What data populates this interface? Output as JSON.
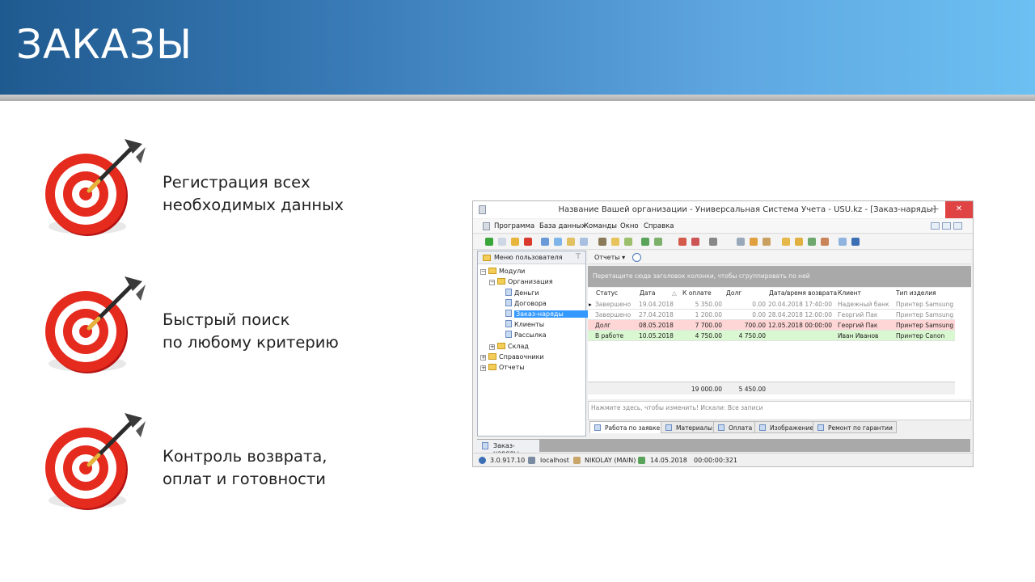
{
  "slide": {
    "title": "ЗАКАЗЫ",
    "features": [
      {
        "line1": "Регистрация всех",
        "line2": "необходимых данных"
      },
      {
        "line1": "Быстрый поиск",
        "line2": "по любому критерию"
      },
      {
        "line1": "Контроль возврата,",
        "line2": "оплат и готовности"
      }
    ]
  },
  "window": {
    "title": "Название Вашей организации - Универсальная Система Учета - USU.kz - [Заказ-наряды]",
    "controls": {
      "minimize": "—",
      "maximize": "☐",
      "close": "✕"
    },
    "menu": [
      "Программа",
      "База данных",
      "Команды",
      "Окно",
      "Справка"
    ],
    "sidebar": {
      "header": "Меню пользователя",
      "pin": "⊤",
      "tree": [
        {
          "label": "Модули",
          "type": "folder",
          "level": 0
        },
        {
          "label": "Организация",
          "type": "folder",
          "level": 1
        },
        {
          "label": "Деньги",
          "type": "doc",
          "level": 2
        },
        {
          "label": "Договора",
          "type": "doc",
          "level": 2
        },
        {
          "label": "Заказ-наряды",
          "type": "doc",
          "level": 2,
          "selected": true
        },
        {
          "label": "Клиенты",
          "type": "doc",
          "level": 2
        },
        {
          "label": "Рассылка",
          "type": "doc",
          "level": 2
        },
        {
          "label": "Склад",
          "type": "folder",
          "level": 1
        },
        {
          "label": "Справочники",
          "type": "folder",
          "level": 0
        },
        {
          "label": "Отчеты",
          "type": "folder",
          "level": 0
        }
      ]
    },
    "reports_button": "Отчеты ▾",
    "group_hint": "Перетащите сюда заголовок колонки, чтобы сгруппировать по ней",
    "grid": {
      "columns": [
        "Статус",
        "Дата",
        "К оплате",
        "Долг",
        "Дата/время возврата",
        "Клиент",
        "Тип изделия"
      ],
      "rows": [
        {
          "status": "Завершено",
          "date": "19.04.2018",
          "to_pay": "5 350.00",
          "debt": "0.00",
          "return": "20.04.2018 17:40:00",
          "client": "Надежный банк",
          "item": "Принтер Samsung",
          "kind": "done"
        },
        {
          "status": "Завершено",
          "date": "27.04.2018",
          "to_pay": "1 200.00",
          "debt": "0.00",
          "return": "28.04.2018 12:00:00",
          "client": "Георгий Пак",
          "item": "Принтер Samsung",
          "kind": "done"
        },
        {
          "status": "Долг",
          "date": "08.05.2018",
          "to_pay": "7 700.00",
          "debt": "700.00",
          "return": "12.05.2018 00:00:00",
          "client": "Георгий Пак",
          "item": "Принтер Samsung",
          "kind": "debt"
        },
        {
          "status": "В работе",
          "date": "10.05.2018",
          "to_pay": "4 750.00",
          "debt": "4 750.00",
          "return": "",
          "client": "Иван Иванов",
          "item": "Принтер Canon",
          "kind": "work"
        }
      ],
      "totals": {
        "to_pay": "19 000.00",
        "debt": "5 450.00"
      }
    },
    "notes_hint": "Нажмите здесь, чтобы изменить! Искали: Все записи",
    "tabs": [
      "Работа по заявке",
      "Материалы",
      "Оплата",
      "Изображение",
      "Ремонт по гарантии"
    ],
    "document_tab": "Заказ-наряды",
    "status": {
      "version": "3.0.917.10",
      "host": "localhost",
      "user": "NIKOLAY (MAIN)",
      "date": "14.05.2018",
      "timer": "00:00:00:321"
    }
  }
}
